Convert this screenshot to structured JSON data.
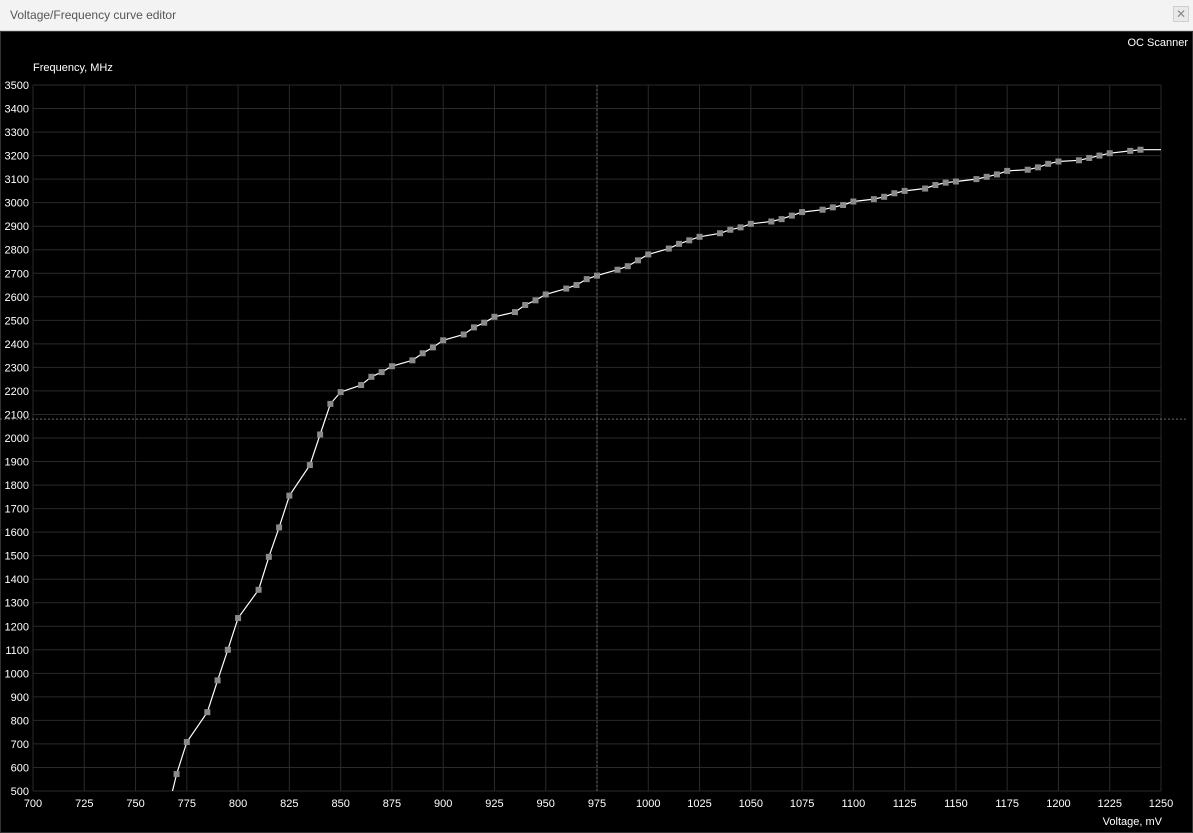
{
  "window": {
    "title": "Voltage/Frequency curve editor",
    "close_glyph": "✕"
  },
  "toolbar": {
    "oc_scanner_label": "OC Scanner"
  },
  "chart_data": {
    "type": "line",
    "title": "",
    "xlabel": "Voltage, mV",
    "ylabel": "Frequency, MHz",
    "xlim": [
      700,
      1250
    ],
    "ylim": [
      500,
      3500
    ],
    "x_ticks": [
      700,
      725,
      750,
      775,
      800,
      825,
      850,
      875,
      900,
      925,
      950,
      975,
      1000,
      1025,
      1050,
      1075,
      1100,
      1125,
      1150,
      1175,
      1200,
      1225,
      1250
    ],
    "y_ticks": [
      500,
      600,
      700,
      800,
      900,
      1000,
      1100,
      1200,
      1300,
      1400,
      1500,
      1600,
      1700,
      1800,
      1900,
      2000,
      2100,
      2200,
      2300,
      2400,
      2500,
      2600,
      2700,
      2800,
      2900,
      3000,
      3100,
      3200,
      3300,
      3400,
      3500
    ],
    "grid": true,
    "crosshair": {
      "voltage": 975,
      "frequency": 2080
    },
    "line_start": {
      "x": 768,
      "y": 500
    },
    "line_end": {
      "x": 1250,
      "y": 3225
    },
    "series": [
      {
        "points": [
          [
            770,
            572
          ],
          [
            775,
            708
          ],
          [
            785,
            835
          ],
          [
            790,
            970
          ],
          [
            795,
            1100
          ],
          [
            800,
            1235
          ],
          [
            810,
            1355
          ],
          [
            815,
            1495
          ],
          [
            820,
            1620
          ],
          [
            825,
            1755
          ],
          [
            835,
            1885
          ],
          [
            840,
            2015
          ],
          [
            845,
            2145
          ],
          [
            850,
            2195
          ],
          [
            860,
            2225
          ],
          [
            865,
            2260
          ],
          [
            870,
            2280
          ],
          [
            875,
            2305
          ],
          [
            885,
            2330
          ],
          [
            890,
            2360
          ],
          [
            895,
            2385
          ],
          [
            900,
            2415
          ],
          [
            910,
            2440
          ],
          [
            915,
            2470
          ],
          [
            920,
            2490
          ],
          [
            925,
            2515
          ],
          [
            935,
            2535
          ],
          [
            940,
            2565
          ],
          [
            945,
            2585
          ],
          [
            950,
            2610
          ],
          [
            960,
            2635
          ],
          [
            965,
            2650
          ],
          [
            970,
            2675
          ],
          [
            975,
            2690
          ],
          [
            985,
            2715
          ],
          [
            990,
            2730
          ],
          [
            995,
            2755
          ],
          [
            1000,
            2780
          ],
          [
            1010,
            2805
          ],
          [
            1015,
            2825
          ],
          [
            1020,
            2840
          ],
          [
            1025,
            2855
          ],
          [
            1035,
            2870
          ],
          [
            1040,
            2885
          ],
          [
            1045,
            2895
          ],
          [
            1050,
            2910
          ],
          [
            1060,
            2920
          ],
          [
            1065,
            2930
          ],
          [
            1070,
            2945
          ],
          [
            1075,
            2960
          ],
          [
            1085,
            2970
          ],
          [
            1090,
            2980
          ],
          [
            1095,
            2990
          ],
          [
            1100,
            3005
          ],
          [
            1110,
            3015
          ],
          [
            1115,
            3025
          ],
          [
            1120,
            3040
          ],
          [
            1125,
            3050
          ],
          [
            1135,
            3060
          ],
          [
            1140,
            3075
          ],
          [
            1145,
            3085
          ],
          [
            1150,
            3090
          ],
          [
            1160,
            3100
          ],
          [
            1165,
            3110
          ],
          [
            1170,
            3120
          ],
          [
            1175,
            3135
          ],
          [
            1185,
            3140
          ],
          [
            1190,
            3150
          ],
          [
            1195,
            3165
          ],
          [
            1200,
            3175
          ],
          [
            1210,
            3180
          ],
          [
            1215,
            3190
          ],
          [
            1220,
            3200
          ],
          [
            1225,
            3210
          ],
          [
            1235,
            3220
          ],
          [
            1240,
            3225
          ]
        ]
      }
    ]
  }
}
